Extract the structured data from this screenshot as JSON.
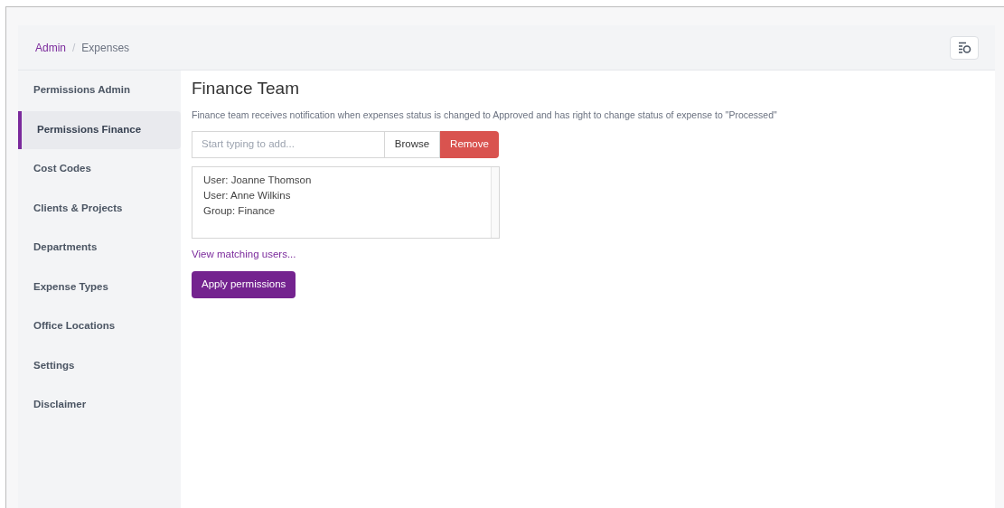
{
  "breadcrumb": [
    {
      "label": "Admin",
      "link": true
    },
    {
      "label": "Expenses",
      "link": false
    }
  ],
  "breadcrumb_separator": "/",
  "sidebar": {
    "items": [
      {
        "label": "Permissions Admin",
        "selected": false
      },
      {
        "label": "Permissions Finance",
        "selected": true
      },
      {
        "label": "Cost Codes",
        "selected": false
      },
      {
        "label": "Clients & Projects",
        "selected": false
      },
      {
        "label": "Departments",
        "selected": false
      },
      {
        "label": "Expense Types",
        "selected": false
      },
      {
        "label": "Office Locations",
        "selected": false
      },
      {
        "label": "Settings",
        "selected": false
      },
      {
        "label": "Disclaimer",
        "selected": false
      }
    ]
  },
  "main": {
    "title": "Finance Team",
    "description": "Finance team receives notification when expenses status is changed to Approved and has right to change status of expense to \"Processed\"",
    "search": {
      "placeholder": "Start typing to add..."
    },
    "browse_button": "Browse",
    "remove_button": "Remove",
    "members": [
      "User: Joanne Thomson",
      "User: Anne Wilkins",
      "Group: Finance"
    ],
    "link": "View matching users...",
    "apply_button": "Apply permissions"
  }
}
